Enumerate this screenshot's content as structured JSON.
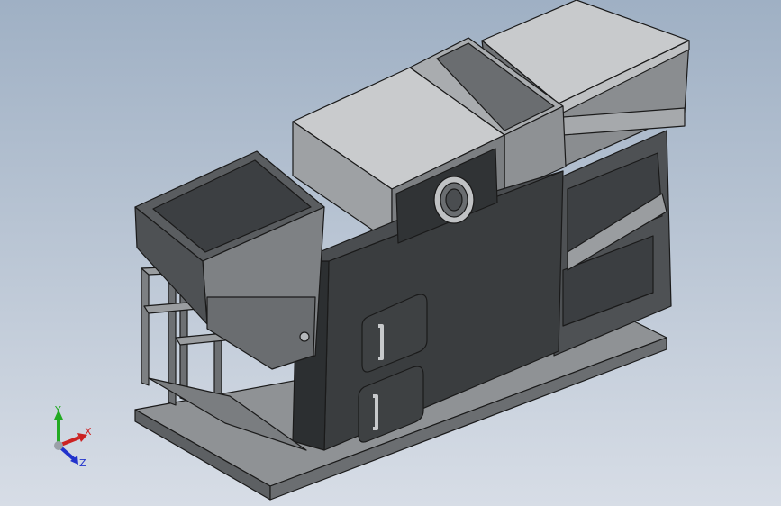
{
  "viewport": {
    "background_top": "#9fb0c4",
    "background_bottom": "#d7dde6"
  },
  "model": {
    "description_icon": "cad-boiler-assembly",
    "colors": {
      "dark_panel": "#3a3d3f",
      "mid_panel": "#5a5d60",
      "light_panel": "#b9bcbf",
      "top_face": "#c9cbcd",
      "edge": "#1a1a1a",
      "frame": "#8a8d90"
    }
  },
  "triad": {
    "x_label": "X",
    "y_label": "Y",
    "z_label": "Z",
    "x_color": "#cc2222",
    "y_color": "#22aa22",
    "z_color": "#2233cc"
  }
}
